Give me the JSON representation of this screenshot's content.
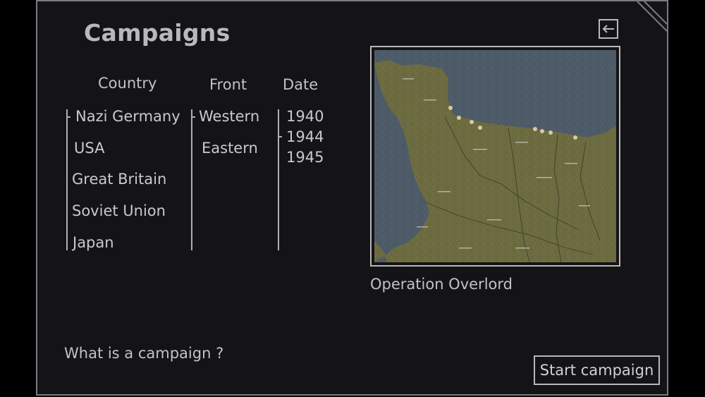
{
  "screen": {
    "title": "Campaigns",
    "back_icon": "arrow-left-icon"
  },
  "columns": {
    "country": "Country",
    "front": "Front",
    "date": "Date"
  },
  "countries": [
    "Nazi Germany",
    "USA",
    "Great Britain",
    "Soviet Union",
    "Japan"
  ],
  "fronts": [
    "Western",
    "Eastern"
  ],
  "dates": [
    "1940",
    "1944",
    "1945"
  ],
  "selected": {
    "country": "Nazi Germany",
    "front": "Western",
    "date": "1944"
  },
  "map": {
    "caption": "Operation Overlord",
    "sea_color": "#4b5a66",
    "land_color": "#6b6a3f"
  },
  "help_link": "What is a campaign ?",
  "start_button": "Start campaign"
}
